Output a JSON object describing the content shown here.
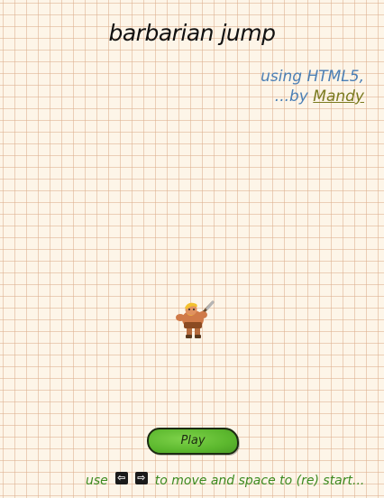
{
  "game": {
    "title": "barbarian jump",
    "credits_tech": "using HTML5,",
    "credits_prefix": "...by",
    "credits_author": "Mandy"
  },
  "player": {
    "icon": "barbarian-character-icon"
  },
  "controls": {
    "play_label": "Play",
    "instruction_prefix": "use",
    "left_key_glyph": "⇦",
    "right_key_glyph": "⇨",
    "instruction_suffix": "to move and space to (re) start..."
  },
  "colors": {
    "background": "#fdf5e8",
    "grid": "#dcaf8c",
    "play_button": "#5cb82e",
    "credits_text": "#4b7fb5",
    "author_link": "#7a7a1f",
    "instructions_text": "#3c8a1f"
  }
}
